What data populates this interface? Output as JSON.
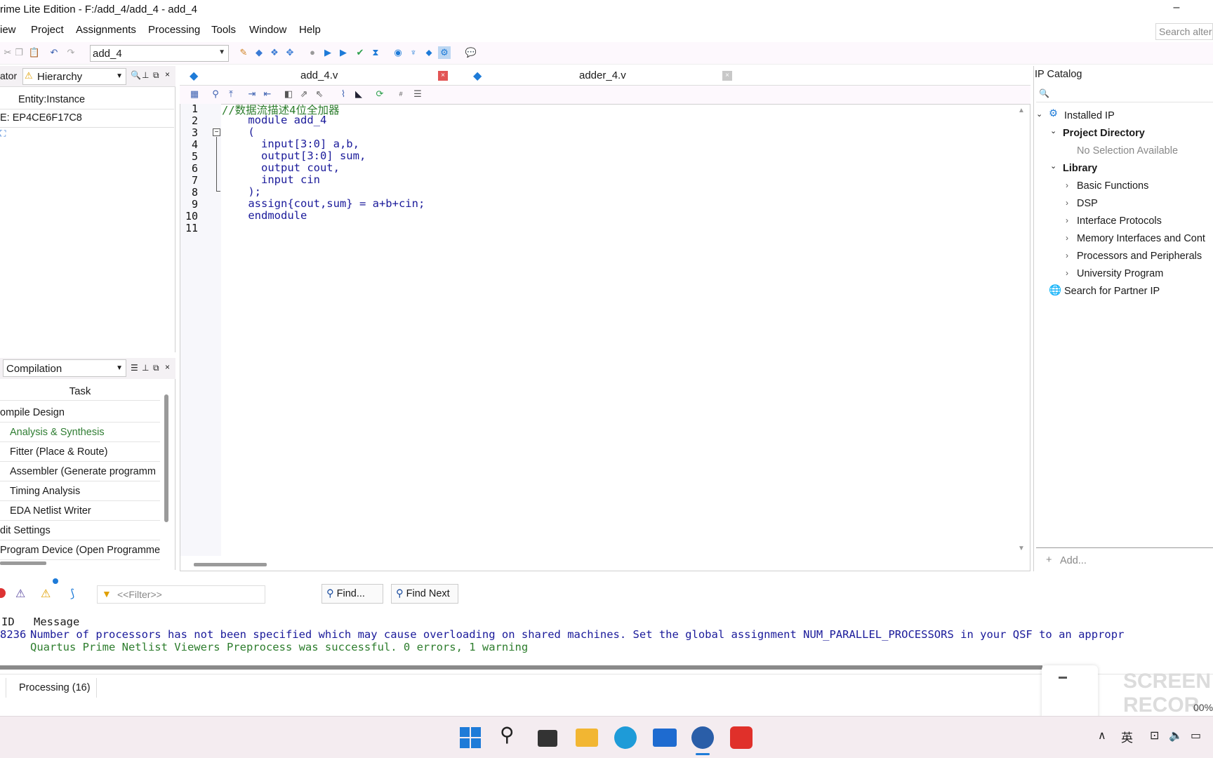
{
  "window": {
    "title": "rime Lite Edition - F:/add_4/add_4 - add_4",
    "minimize": "–"
  },
  "menu": [
    "iew",
    "Project",
    "Assignments",
    "Processing",
    "Tools",
    "Window",
    "Help"
  ],
  "search_alt": "Search alter",
  "toolbar": {
    "entity": "add_4"
  },
  "navigator": {
    "title_fragment": "ator",
    "hierarchy_label": "Hierarchy",
    "column": "Entity:Instance",
    "device": "E: EP4CE6F17C8"
  },
  "tasks": {
    "flow": "Compilation",
    "header": "Task",
    "rows": [
      "ompile Design",
      "Analysis & Synthesis",
      "Fitter (Place & Route)",
      "Assembler (Generate programm",
      "Timing Analysis",
      "EDA Netlist Writer",
      "dit Settings",
      "Program Device (Open Programme"
    ]
  },
  "editor": {
    "tabs": [
      "add_4.v",
      "adder_4.v"
    ],
    "line_numbers": [
      "1",
      "2",
      "3",
      "4",
      "5",
      "6",
      "7",
      "8",
      "9",
      "10",
      "11"
    ],
    "lines": [
      "//数据流描述4位全加器",
      "    module add_4",
      "    (",
      "      input[3:0] a,b,",
      "      output[3:0] sum,",
      "      output cout,",
      "      input cin",
      "    );",
      "    assign{cout,sum} = a+b+cin;",
      "    endmodule",
      ""
    ]
  },
  "ip_catalog": {
    "title": "IP Catalog",
    "installed": "Installed IP",
    "project_dir": "Project Directory",
    "no_selection": "No Selection Available",
    "library": "Library",
    "items": [
      "Basic Functions",
      "DSP",
      "Interface Protocols",
      "Memory Interfaces and Cont",
      "Processors and Peripherals",
      "University Program"
    ],
    "partner": "Search for Partner IP",
    "add": "Add..."
  },
  "messages": {
    "filter_placeholder": "<<Filter>>",
    "find": "Find...",
    "find_next": "Find Next",
    "col_id": "ID",
    "col_message": "Message",
    "row1_id": "8236",
    "row1": "Number of processors has not been specified which may cause overloading on shared machines.  Set the global assignment NUM_PARALLEL_PROCESSORS in your QSF to an appropr",
    "row2": "Quartus Prime Netlist Viewers Preprocess was successful. 0 errors, 1 warning"
  },
  "status": {
    "processing_tab": "Processing (16)"
  },
  "overlay": {
    "watermark": "SCREEN RECOR",
    "percent": "00%"
  },
  "taskbar": {
    "ime": "英"
  }
}
